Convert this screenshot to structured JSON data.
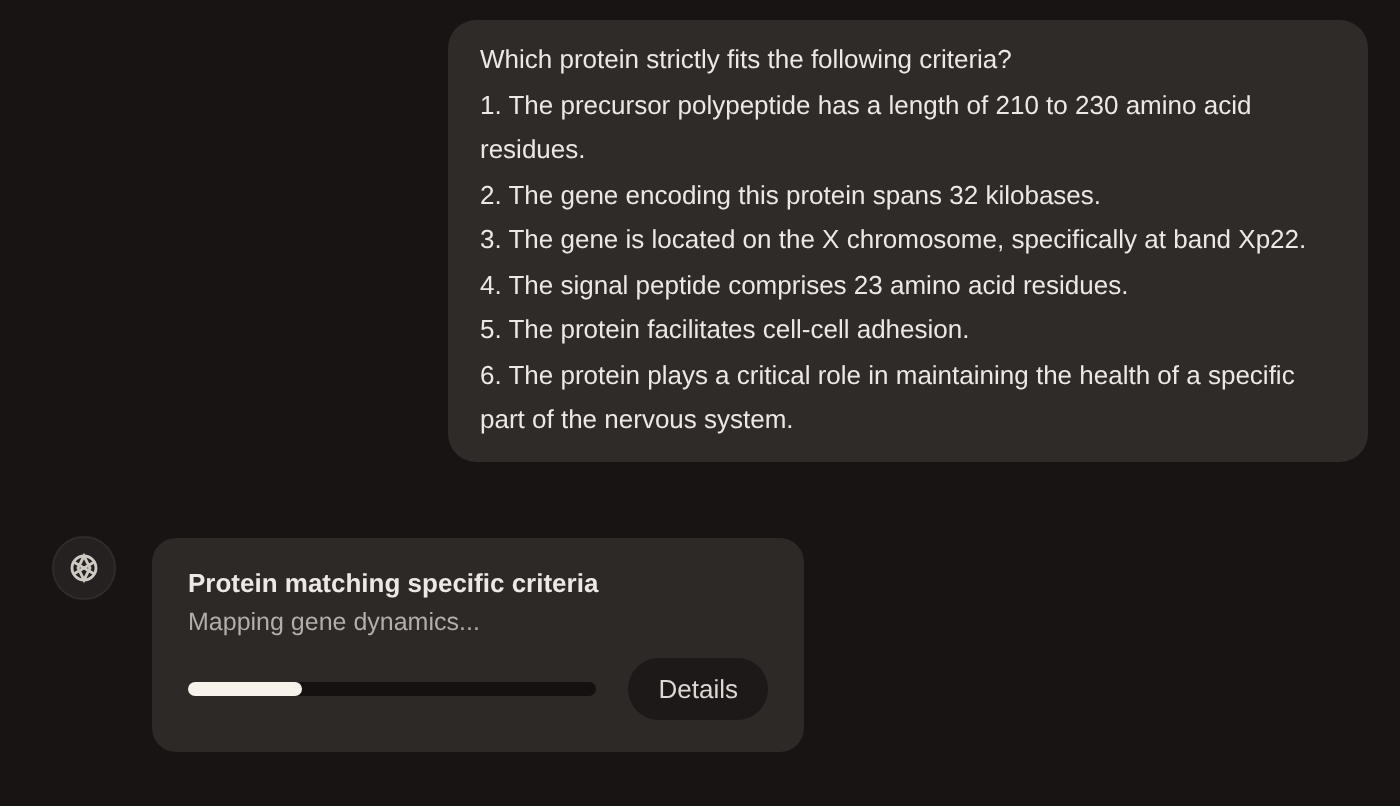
{
  "user_message": {
    "lines": [
      "Which protein strictly fits the following criteria?",
      "1. The precursor polypeptide has a length of 210 to 230 amino acid residues.",
      "2. The gene encoding this protein spans 32 kilobases.",
      "3. The gene is located on the X chromosome, specifically at band Xp22.",
      "4. The signal peptide comprises 23 amino acid residues.",
      "5. The protein facilitates cell-cell adhesion.",
      "6. The protein plays a critical role in maintaining the health of a specific part of the nervous system."
    ]
  },
  "task_card": {
    "title": "Protein matching specific criteria",
    "status": "Mapping gene dynamics...",
    "progress": {
      "level": 0.28
    },
    "button": "Details"
  }
}
